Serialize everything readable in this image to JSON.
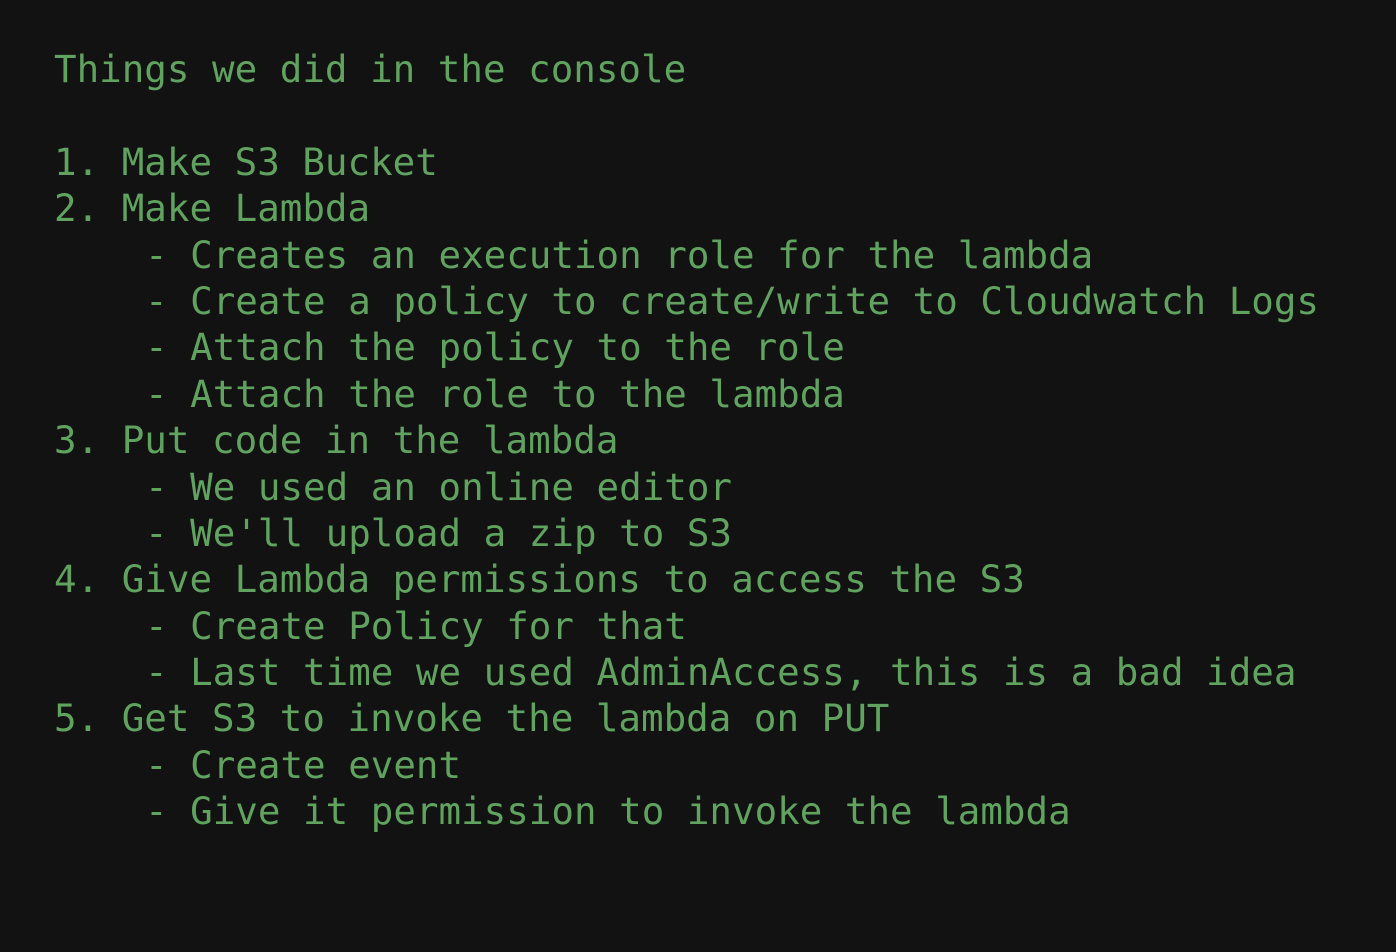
{
  "title": "Things we did in the console",
  "items": [
    {
      "text": "1. Make S3 Bucket",
      "subitems": []
    },
    {
      "text": "2. Make Lambda",
      "subitems": [
        "- Creates an execution role for the lambda",
        "- Create a policy to create/write to Cloudwatch Logs",
        "- Attach the policy to the role",
        "- Attach the role to the lambda"
      ]
    },
    {
      "text": "3. Put code in the lambda",
      "subitems": [
        "- We used an online editor",
        "- We'll upload a zip to S3"
      ]
    },
    {
      "text": "4. Give Lambda permissions to access the S3",
      "subitems": [
        "- Create Policy for that",
        "- Last time we used AdminAccess, this is a bad idea"
      ]
    },
    {
      "text": "5. Get S3 to invoke the lambda on PUT",
      "subitems": [
        "- Create event",
        "- Give it permission to invoke the lambda"
      ]
    }
  ],
  "colors": {
    "background": "#121212",
    "text": "#5fa35f"
  }
}
